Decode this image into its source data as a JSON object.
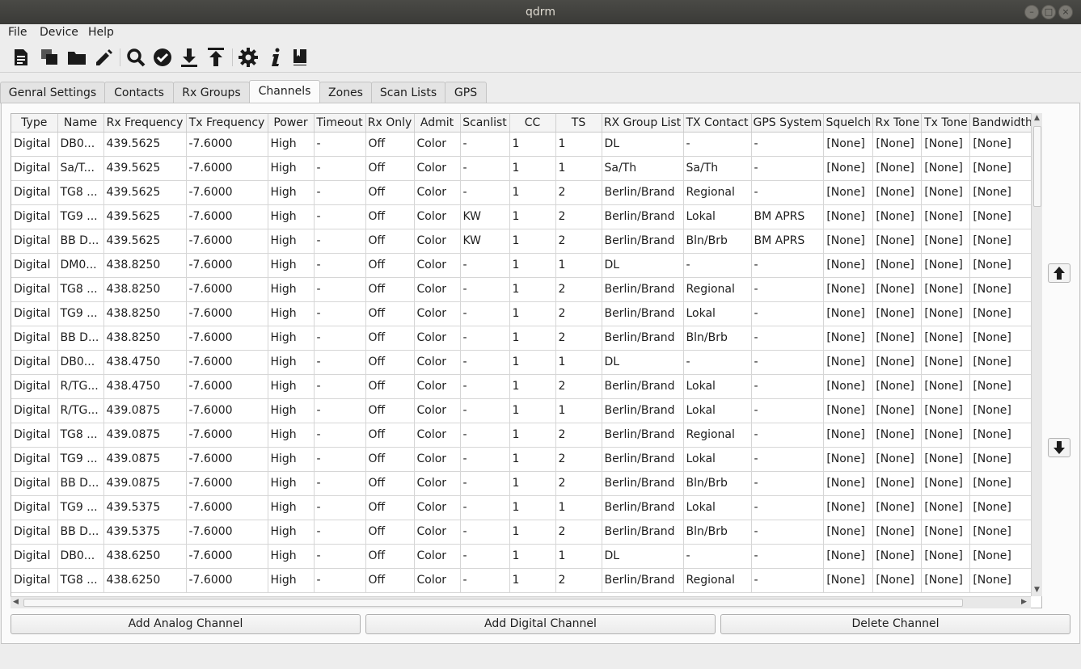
{
  "window": {
    "title": "qdrm"
  },
  "menu": [
    "File",
    "Device",
    "Help"
  ],
  "toolbar": {
    "icons": [
      "new-document-icon",
      "copy-icon",
      "open-folder-icon",
      "edit-pencil-icon",
      "search-icon",
      "verify-check-icon",
      "download-icon",
      "upload-icon",
      "settings-gear-icon",
      "info-icon",
      "book-icon"
    ]
  },
  "tabs": [
    {
      "label": "Genral Settings"
    },
    {
      "label": "Contacts"
    },
    {
      "label": "Rx Groups"
    },
    {
      "label": "Channels",
      "active": true
    },
    {
      "label": "Zones"
    },
    {
      "label": "Scan Lists"
    },
    {
      "label": "GPS"
    }
  ],
  "table": {
    "columns": [
      "Type",
      "Name",
      "Rx Frequency",
      "Tx Frequency",
      "Power",
      "Timeout",
      "Rx Only",
      "Admit",
      "Scanlist",
      "CC",
      "TS",
      "RX Group List",
      "TX Contact",
      "GPS System",
      "Squelch",
      "Rx Tone",
      "Tx Tone",
      "Bandwidth"
    ],
    "rows": [
      [
        "Digital",
        "DB0...",
        "439.5625",
        "-7.6000",
        "High",
        "-",
        "Off",
        "Color",
        "-",
        "1",
        "1",
        "DL",
        "-",
        "-",
        "[None]",
        "[None]",
        "[None]",
        "[None]"
      ],
      [
        "Digital",
        "Sa/T...",
        "439.5625",
        "-7.6000",
        "High",
        "-",
        "Off",
        "Color",
        "-",
        "1",
        "1",
        "Sa/Th",
        "Sa/Th",
        "-",
        "[None]",
        "[None]",
        "[None]",
        "[None]"
      ],
      [
        "Digital",
        "TG8 ...",
        "439.5625",
        "-7.6000",
        "High",
        "-",
        "Off",
        "Color",
        "-",
        "1",
        "2",
        "Berlin/Brand",
        "Regional",
        "-",
        "[None]",
        "[None]",
        "[None]",
        "[None]"
      ],
      [
        "Digital",
        "TG9 ...",
        "439.5625",
        "-7.6000",
        "High",
        "-",
        "Off",
        "Color",
        "KW",
        "1",
        "2",
        "Berlin/Brand",
        "Lokal",
        "BM APRS",
        "[None]",
        "[None]",
        "[None]",
        "[None]"
      ],
      [
        "Digital",
        "BB D...",
        "439.5625",
        "-7.6000",
        "High",
        "-",
        "Off",
        "Color",
        "KW",
        "1",
        "2",
        "Berlin/Brand",
        "Bln/Brb",
        "BM APRS",
        "[None]",
        "[None]",
        "[None]",
        "[None]"
      ],
      [
        "Digital",
        "DM0...",
        "438.8250",
        "-7.6000",
        "High",
        "-",
        "Off",
        "Color",
        "-",
        "1",
        "1",
        "DL",
        "-",
        "-",
        "[None]",
        "[None]",
        "[None]",
        "[None]"
      ],
      [
        "Digital",
        "TG8 ...",
        "438.8250",
        "-7.6000",
        "High",
        "-",
        "Off",
        "Color",
        "-",
        "1",
        "2",
        "Berlin/Brand",
        "Regional",
        "-",
        "[None]",
        "[None]",
        "[None]",
        "[None]"
      ],
      [
        "Digital",
        "TG9 ...",
        "438.8250",
        "-7.6000",
        "High",
        "-",
        "Off",
        "Color",
        "-",
        "1",
        "2",
        "Berlin/Brand",
        "Lokal",
        "-",
        "[None]",
        "[None]",
        "[None]",
        "[None]"
      ],
      [
        "Digital",
        "BB D...",
        "438.8250",
        "-7.6000",
        "High",
        "-",
        "Off",
        "Color",
        "-",
        "1",
        "2",
        "Berlin/Brand",
        "Bln/Brb",
        "-",
        "[None]",
        "[None]",
        "[None]",
        "[None]"
      ],
      [
        "Digital",
        "DB0...",
        "438.4750",
        "-7.6000",
        "High",
        "-",
        "Off",
        "Color",
        "-",
        "1",
        "1",
        "DL",
        "-",
        "-",
        "[None]",
        "[None]",
        "[None]",
        "[None]"
      ],
      [
        "Digital",
        "R/TG...",
        "438.4750",
        "-7.6000",
        "High",
        "-",
        "Off",
        "Color",
        "-",
        "1",
        "2",
        "Berlin/Brand",
        "Lokal",
        "-",
        "[None]",
        "[None]",
        "[None]",
        "[None]"
      ],
      [
        "Digital",
        "R/TG...",
        "439.0875",
        "-7.6000",
        "High",
        "-",
        "Off",
        "Color",
        "-",
        "1",
        "1",
        "Berlin/Brand",
        "Lokal",
        "-",
        "[None]",
        "[None]",
        "[None]",
        "[None]"
      ],
      [
        "Digital",
        "TG8 ...",
        "439.0875",
        "-7.6000",
        "High",
        "-",
        "Off",
        "Color",
        "-",
        "1",
        "2",
        "Berlin/Brand",
        "Regional",
        "-",
        "[None]",
        "[None]",
        "[None]",
        "[None]"
      ],
      [
        "Digital",
        "TG9 ...",
        "439.0875",
        "-7.6000",
        "High",
        "-",
        "Off",
        "Color",
        "-",
        "1",
        "2",
        "Berlin/Brand",
        "Lokal",
        "-",
        "[None]",
        "[None]",
        "[None]",
        "[None]"
      ],
      [
        "Digital",
        "BB D...",
        "439.0875",
        "-7.6000",
        "High",
        "-",
        "Off",
        "Color",
        "-",
        "1",
        "2",
        "Berlin/Brand",
        "Bln/Brb",
        "-",
        "[None]",
        "[None]",
        "[None]",
        "[None]"
      ],
      [
        "Digital",
        "TG9 ...",
        "439.5375",
        "-7.6000",
        "High",
        "-",
        "Off",
        "Color",
        "-",
        "1",
        "1",
        "Berlin/Brand",
        "Lokal",
        "-",
        "[None]",
        "[None]",
        "[None]",
        "[None]"
      ],
      [
        "Digital",
        "BB D...",
        "439.5375",
        "-7.6000",
        "High",
        "-",
        "Off",
        "Color",
        "-",
        "1",
        "2",
        "Berlin/Brand",
        "Bln/Brb",
        "-",
        "[None]",
        "[None]",
        "[None]",
        "[None]"
      ],
      [
        "Digital",
        "DB0...",
        "438.6250",
        "-7.6000",
        "High",
        "-",
        "Off",
        "Color",
        "-",
        "1",
        "1",
        "DL",
        "-",
        "-",
        "[None]",
        "[None]",
        "[None]",
        "[None]"
      ],
      [
        "Digital",
        "TG8 ...",
        "438.6250",
        "-7.6000",
        "High",
        "-",
        "Off",
        "Color",
        "-",
        "1",
        "2",
        "Berlin/Brand",
        "Regional",
        "-",
        "[None]",
        "[None]",
        "[None]",
        "[None]"
      ]
    ]
  },
  "side_buttons": {
    "up": "arrow-up-icon",
    "down": "arrow-down-icon"
  },
  "buttons": {
    "add_analog": "Add Analog Channel",
    "add_digital": "Add Digital Channel",
    "delete": "Delete Channel"
  }
}
